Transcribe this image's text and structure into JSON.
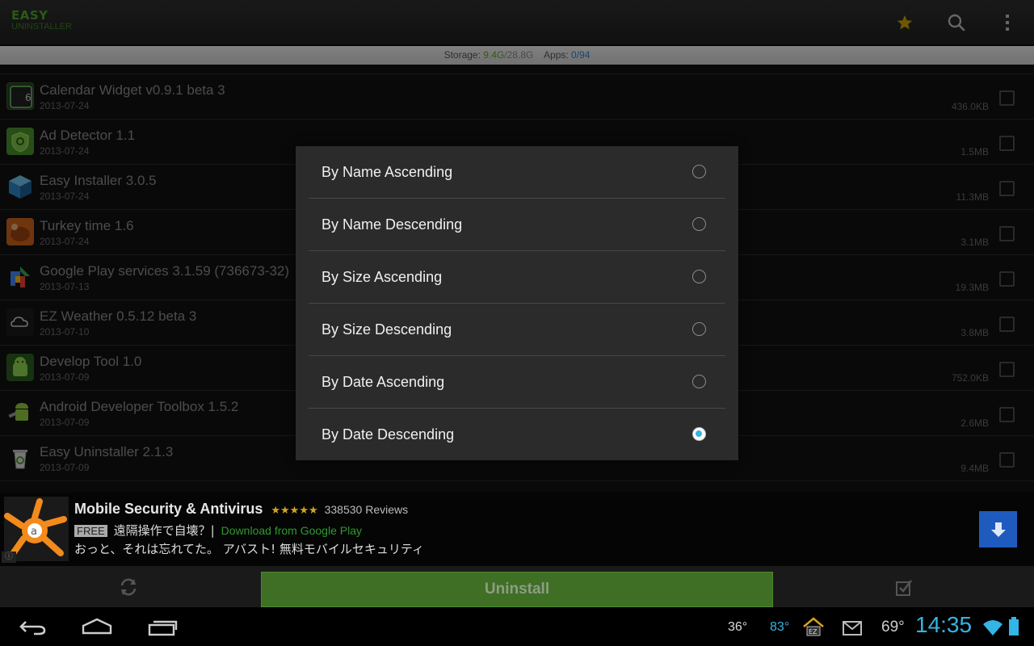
{
  "app": {
    "logo_line1": "EASY",
    "logo_line2": "UNINSTALLER"
  },
  "action_bar": {
    "icons": [
      "star-icon",
      "search-icon",
      "overflow-menu-icon"
    ],
    "star_color": "#c6a000"
  },
  "storage_bar": {
    "storage_label": "Storage:",
    "storage_used": "9.4G",
    "storage_total": "/28.8G",
    "apps_label": "Apps:",
    "apps_selected": "0",
    "apps_total": "/94"
  },
  "app_list": [
    {
      "name": "Calendar Widget v0.9.1 beta 3",
      "date": "2013-07-24",
      "size": "436.0KB",
      "icon": "calendar-widget-icon"
    },
    {
      "name": "Ad Detector 1.1",
      "date": "2013-07-24",
      "size": "1.5MB",
      "icon": "ad-detector-icon"
    },
    {
      "name": "Easy Installer 3.0.5",
      "date": "2013-07-24",
      "size": "11.3MB",
      "icon": "easy-installer-icon"
    },
    {
      "name": "Turkey time 1.6",
      "date": "2013-07-24",
      "size": "3.1MB",
      "icon": "turkey-time-icon"
    },
    {
      "name": "Google Play services 3.1.59 (736673-32)",
      "date": "2013-07-13",
      "size": "19.3MB",
      "icon": "google-play-services-icon"
    },
    {
      "name": "EZ Weather 0.5.12 beta 3",
      "date": "2013-07-10",
      "size": "3.8MB",
      "icon": "ez-weather-icon"
    },
    {
      "name": "Develop Tool 1.0",
      "date": "2013-07-09",
      "size": "752.0KB",
      "icon": "develop-tool-icon"
    },
    {
      "name": "Android Developer Toolbox 1.5.2",
      "date": "2013-07-09",
      "size": "2.6MB",
      "icon": "android-toolbox-icon"
    },
    {
      "name": "Easy Uninstaller 2.1.3",
      "date": "2013-07-09",
      "size": "9.4MB",
      "icon": "easy-uninstaller-icon"
    }
  ],
  "sort_dialog": {
    "options": [
      {
        "label": "By Name Ascending",
        "selected": false
      },
      {
        "label": "By Name Descending",
        "selected": false
      },
      {
        "label": "By Size Ascending",
        "selected": false
      },
      {
        "label": "By Size Descending",
        "selected": false
      },
      {
        "label": "By Date Ascending",
        "selected": false
      },
      {
        "label": "By Date Descending",
        "selected": true
      }
    ],
    "accent": "#33b5e5"
  },
  "ad": {
    "title": "Mobile Security & Antivirus",
    "stars": "★★★★★",
    "reviews": "338530 Reviews",
    "free_badge": "FREE",
    "line2_jp": "遠隔操作で自壊？|",
    "download_link": "Download from Google Play",
    "line3_jp": "おっと、それは忘れてた。 アバスト! 無料モバイルセキュリティ",
    "info": "ⓘ"
  },
  "bottom_bar": {
    "uninstall_label": "Uninstall",
    "uninstall_color": "#3f6f25"
  },
  "system_bar": {
    "temp1": "36°",
    "temp2": "83°",
    "temp3": "69°",
    "clock": "14:35",
    "accent": "#33b5e5"
  }
}
